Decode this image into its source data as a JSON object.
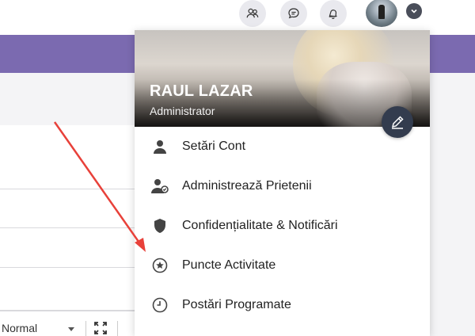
{
  "topbar": {
    "icons": [
      "group-icon",
      "chat-icon",
      "bell-icon"
    ],
    "avatar": "user-avatar",
    "menu_toggle": "chevron-down-icon"
  },
  "editor": {
    "format_select_value": "Normal",
    "expand_icon": "expand-icon"
  },
  "dropdown": {
    "user_name": "RAUL LAZAR",
    "user_role": "Administrator",
    "edit_icon": "pencil-icon",
    "items": [
      {
        "label": "Setări Cont",
        "icon": "user-icon"
      },
      {
        "label": "Administrează Prietenii",
        "icon": "manage-friends-icon"
      },
      {
        "label": "Confidențialitate & Notificări",
        "icon": "shield-icon"
      },
      {
        "label": "Puncte Activitate",
        "icon": "star-circle-icon"
      },
      {
        "label": "Postări Programate",
        "icon": "clock-icon"
      }
    ]
  },
  "colors": {
    "purple_band": "#7b6ab0",
    "edit_button": "#333c4e",
    "annotation_arrow": "#e8413a"
  }
}
